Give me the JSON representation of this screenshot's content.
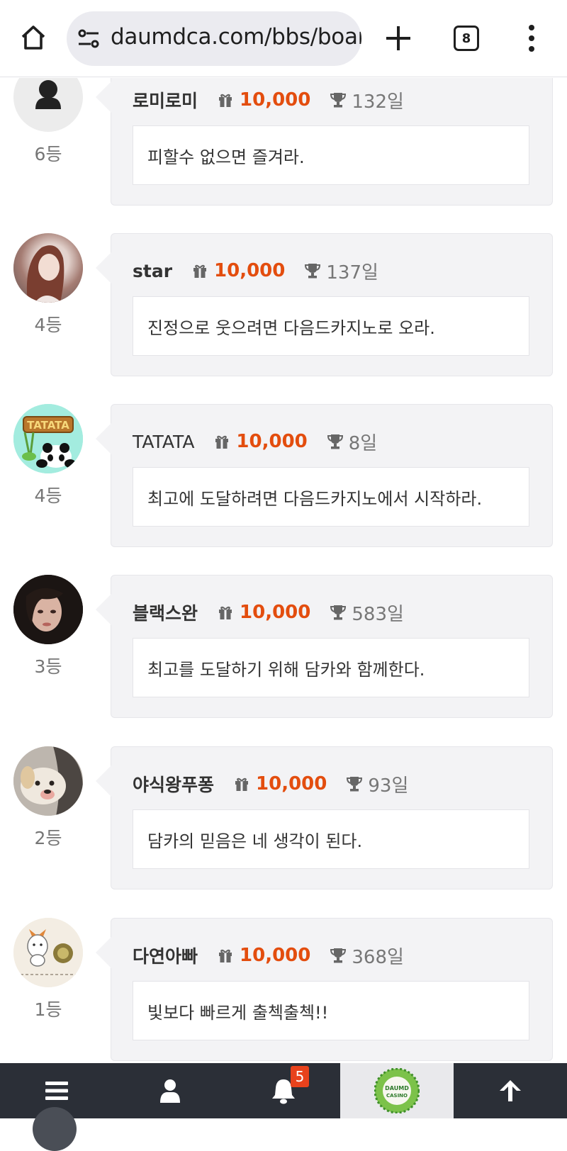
{
  "browser": {
    "url": "daumdca.com/bbs/board",
    "tab_count": "8"
  },
  "colors": {
    "points": "#e34d0e",
    "card_bg": "#f3f3f5",
    "nav_bg": "#2b2f37",
    "badge": "#e8421c"
  },
  "entries": [
    {
      "rank": "6등",
      "username": "로미로미",
      "points": "10,000",
      "days": "132일",
      "message": "피할수 없으면 즐겨라.",
      "avatar": "default-user-icon"
    },
    {
      "rank": "4등",
      "username": "star",
      "points": "10,000",
      "days": "137일",
      "message": "진정으로 웃으려면 다음드카지노로 오라.",
      "avatar": "photo"
    },
    {
      "rank": "4등",
      "username": "TATATA",
      "points": "10,000",
      "days": "8일",
      "message": "최고에 도달하려면 다음드카지노에서 시작하라.",
      "avatar": "TATATA"
    },
    {
      "rank": "3등",
      "username": "블랙스완",
      "points": "10,000",
      "days": "583일",
      "message": "최고를 도달하기 위해 담카와 함께한다.",
      "avatar": "photo"
    },
    {
      "rank": "2등",
      "username": "야식왕푸퐁",
      "points": "10,000",
      "days": "93일",
      "message": "담카의 믿음은 네 생각이 된다.",
      "avatar": "photo"
    },
    {
      "rank": "1등",
      "username": "다연아빠",
      "points": "10,000",
      "days": "368일",
      "message": "빛보다 빠르게 출첵출첵!!",
      "avatar": "illustration"
    }
  ],
  "bottom_nav": {
    "items": [
      "menu-icon",
      "user-icon",
      "bell-icon",
      "daumd-casino-logo",
      "arrow-up-icon"
    ],
    "notification_count": "5",
    "logo_text_top": "DAUMD",
    "logo_text_bottom": "CASINO"
  }
}
